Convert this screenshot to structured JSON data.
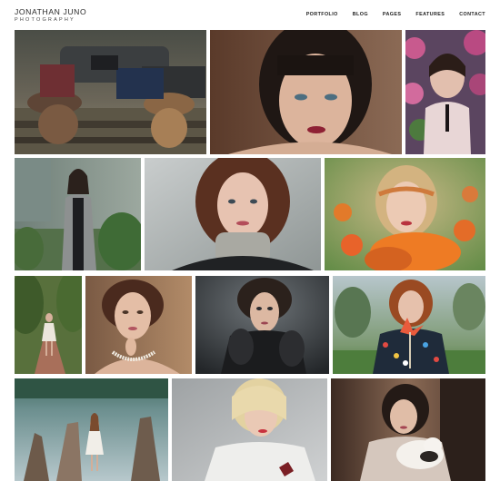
{
  "header": {
    "brand_name": "JONATHAN JUNO",
    "brand_tag": "PHOTOGRAPHY",
    "nav": [
      "PORTFOLIO",
      "BLOG",
      "PAGES",
      "FEATURES",
      "CONTACT"
    ]
  },
  "colors": {
    "background": "#ffffff",
    "nav_text": "#222222"
  }
}
